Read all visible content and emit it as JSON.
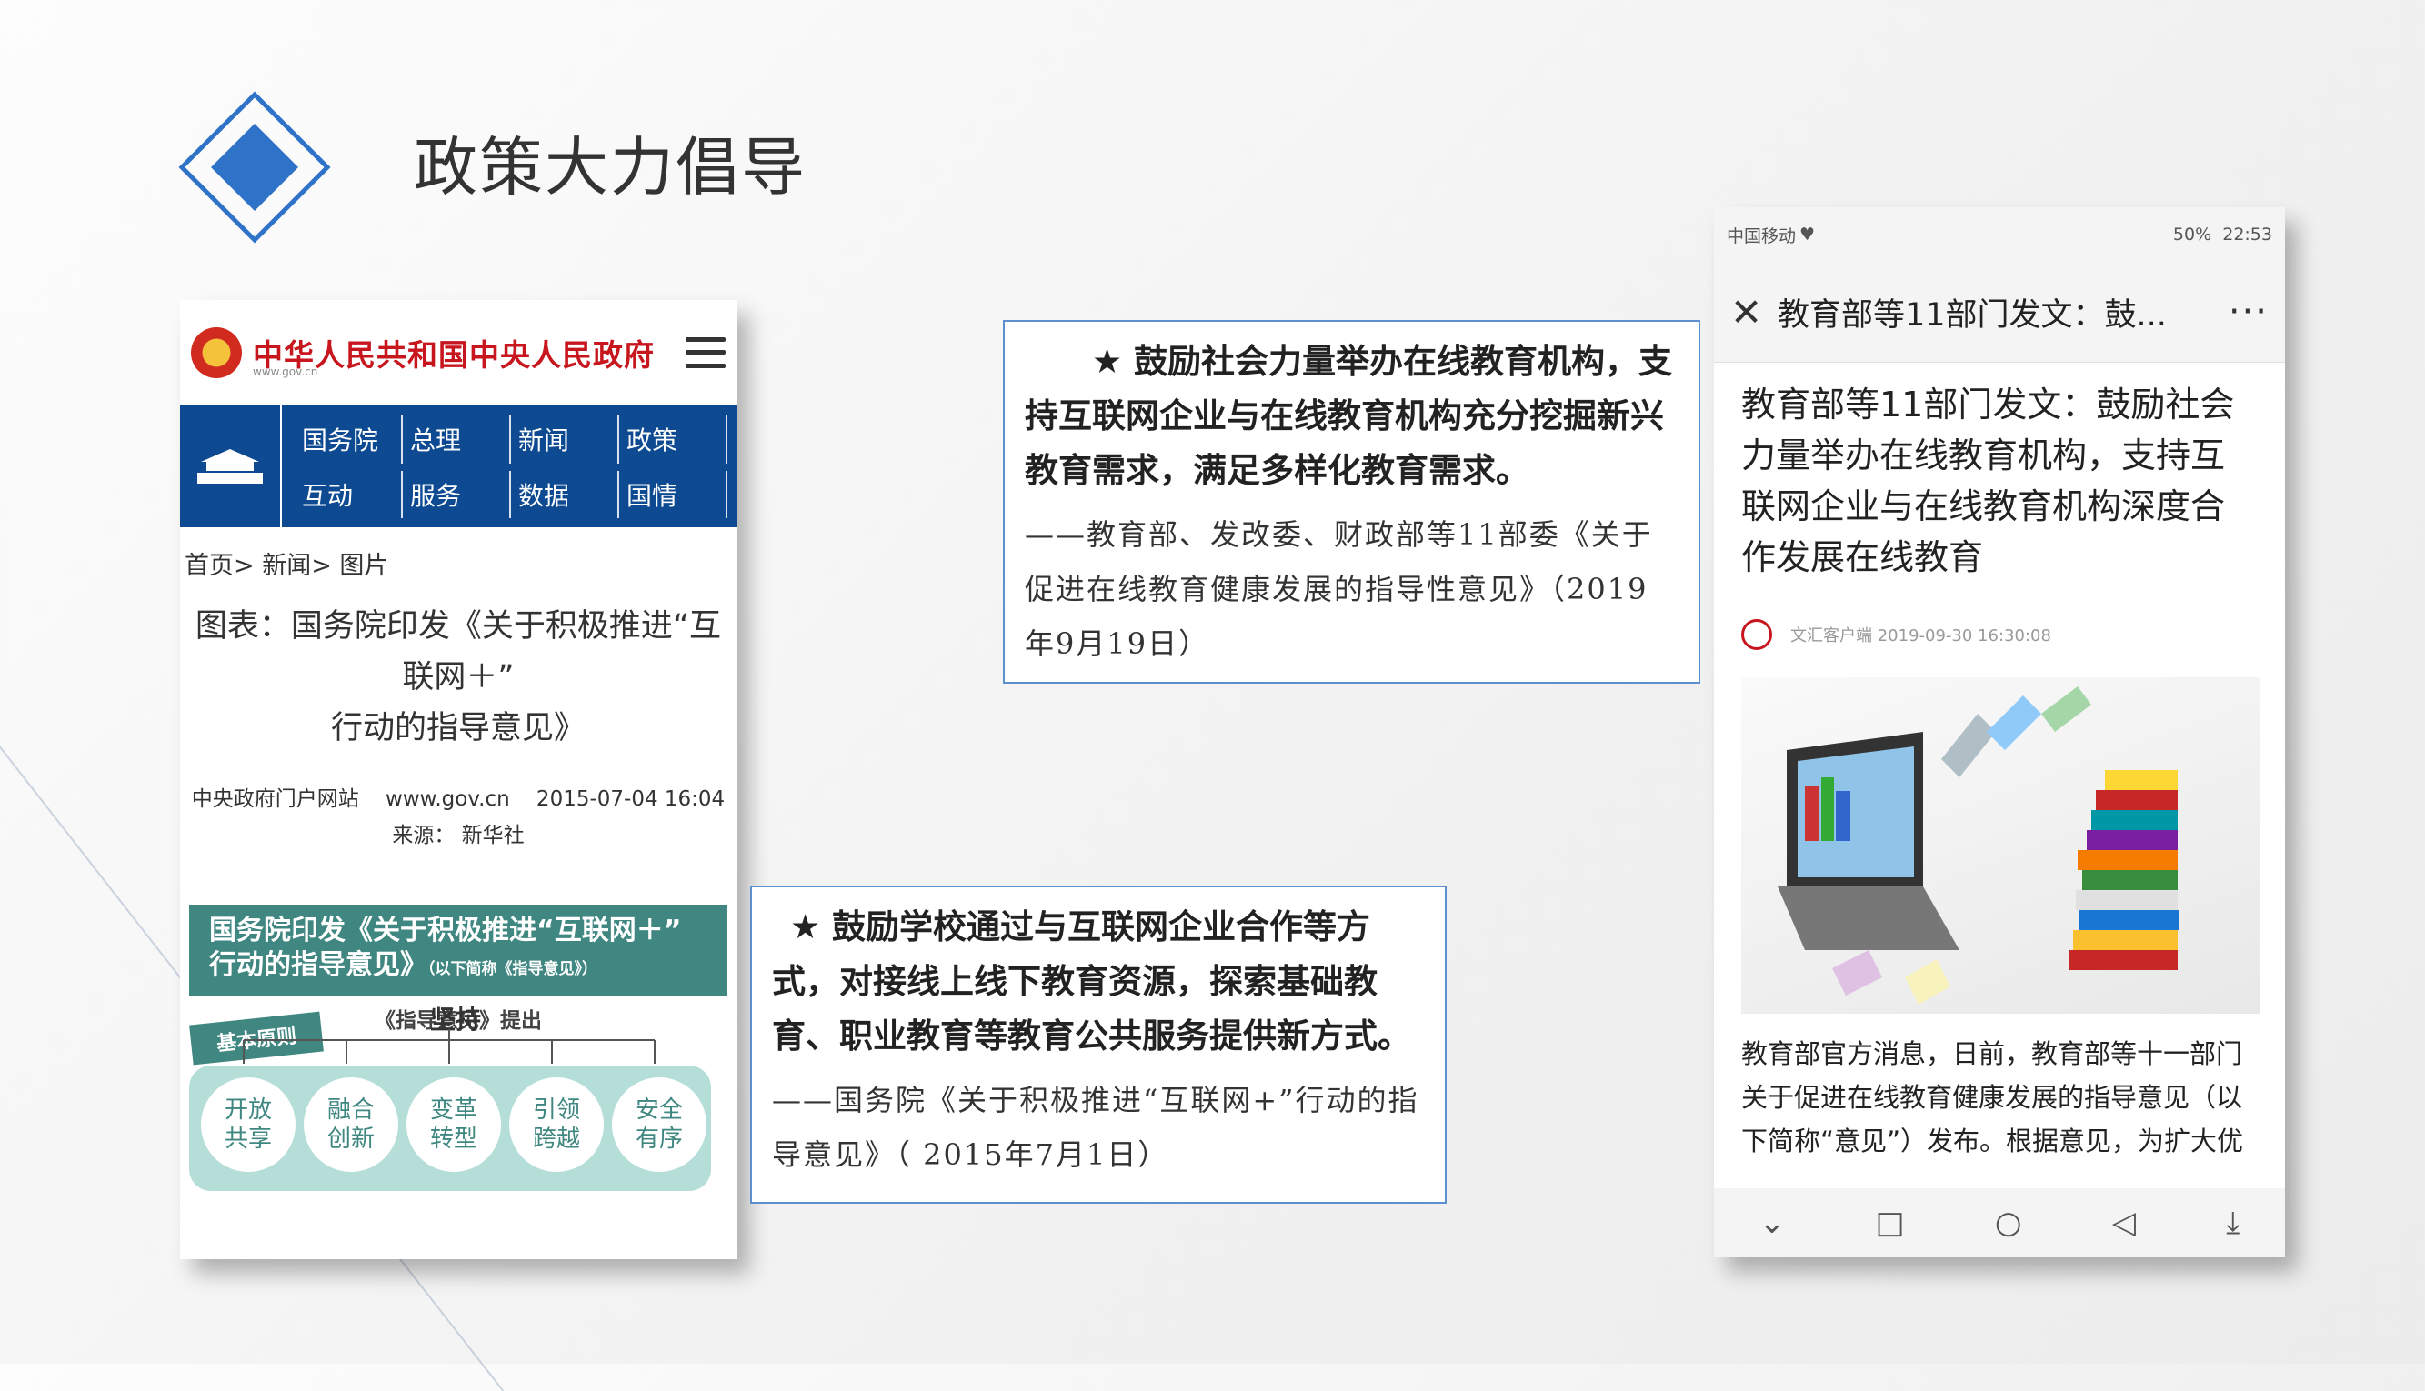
{
  "slide": {
    "title": "政策大力倡导"
  },
  "phone_gov": {
    "site_name": "中华人民共和国中央人民政府",
    "site_url": "www.gov.cn",
    "nav": [
      "国务院",
      "总理",
      "新闻",
      "政策",
      "互动",
      "服务",
      "数据",
      "国情"
    ],
    "breadcrumb": "首页> 新闻> 图片",
    "article_title_1": "图表：国务院印发《关于积极推进“互联网＋”",
    "article_title_2": "行动的指导意见》",
    "meta_line": "中央政府门户网站    www.gov.cn    2015-07-04 16:04",
    "meta_source": "来源： 新华社",
    "info_head_1": "国务院印发《关于积极推进“互联网＋”",
    "info_head_2": "行动的指导意见》",
    "info_head_small": "（以下简称《指导意见》）",
    "info_sub": "《指导意见》提出",
    "badge": "基本原则",
    "center_label": "坚持",
    "principles": [
      "开放\n共享",
      "融合\n创新",
      "变革\n转型",
      "引领\n跨越",
      "安全\n有序"
    ]
  },
  "quote1": {
    "main": "★ 鼓励社会力量举办在线教育机构，支持互联网企业与在线教育机构充分挖掘新兴教育需求，满足多样化教育需求。",
    "source": "——教育部、发改委、财政部等11部委《关于促进在线教育健康发展的指导性意见》（2019年9月19日）"
  },
  "quote2": {
    "main": "★ 鼓励学校通过与互联网企业合作等方式，对接线上线下教育资源，探索基础教育、职业教育等教育公共服务提供新方式。",
    "source": "——国务院《关于积极推进“互联网+”行动的指导意见》（ 2015年7月1日）"
  },
  "phone_news": {
    "carrier": "中国移动",
    "status_right": "50%  22:53",
    "topbar_title": "教育部等11部门发文：鼓...",
    "more": "···",
    "title": "教育部等11部门发文：鼓励社会力量举办在线教育机构，支持互联网企业与在线教育机构深度合作发展在线教育",
    "source": "文汇客户端 2019-09-30 16:30:08",
    "body": "教育部官方消息，日前，教育部等十一部门关于促进在线教育健康发展的指导意见（以下简称“意见”）发布。根据意见，为扩大优质资源供给，将鼓励社会力量举办在线教育"
  },
  "colors": {
    "gov_blue": "#0d4a92",
    "gov_red": "#c8161e",
    "teal": "#3f8780",
    "box_border": "#5b8fd0",
    "logo_blue": "#2f73c9"
  }
}
